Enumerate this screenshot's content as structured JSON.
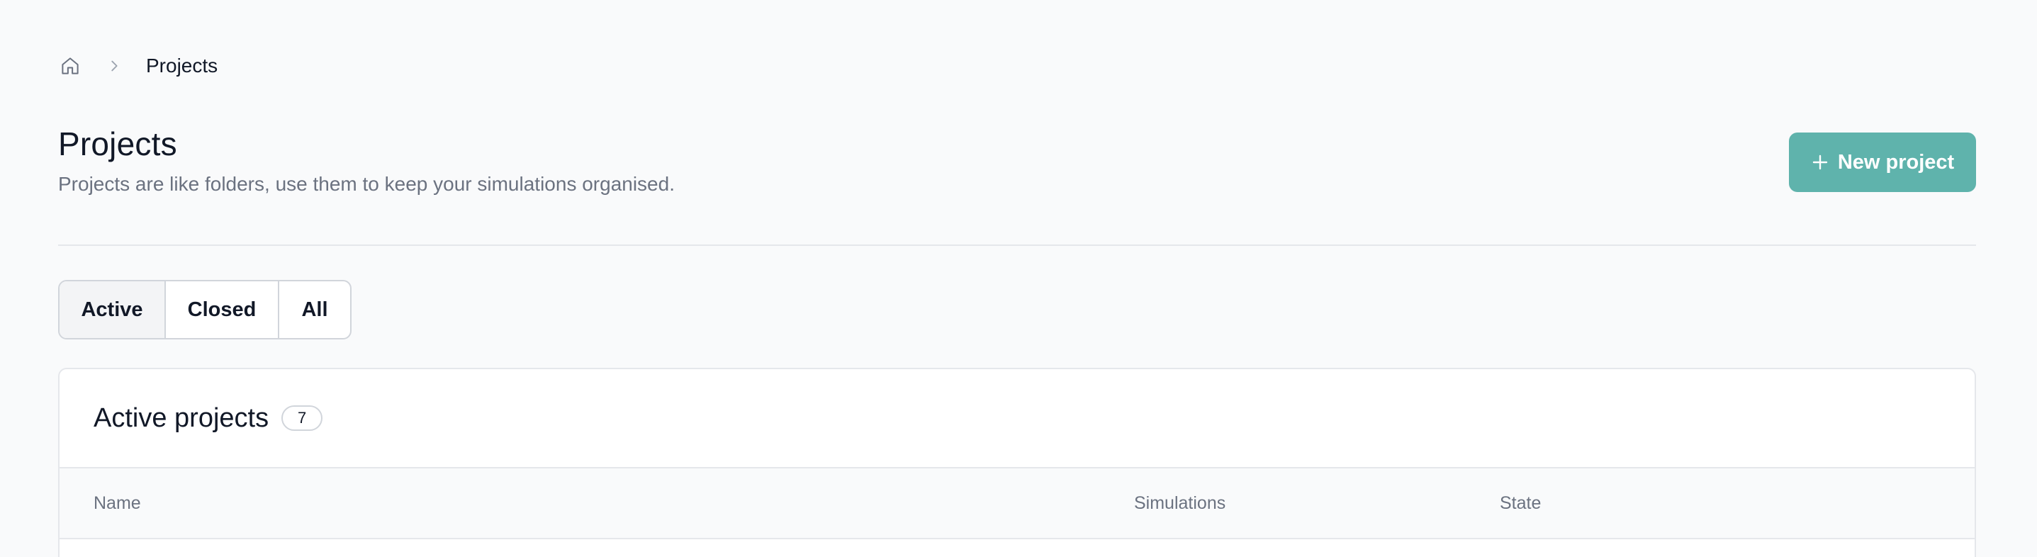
{
  "breadcrumb": {
    "home_icon": "home-icon",
    "separator_icon": "chevron-right-icon",
    "current": "Projects"
  },
  "header": {
    "title": "Projects",
    "subtitle": "Projects are like folders, use them to keep your simulations organised.",
    "new_project_label": "New project",
    "new_project_icon": "plus-icon"
  },
  "tabs": [
    {
      "label": "Active",
      "selected": true
    },
    {
      "label": "Closed",
      "selected": false
    },
    {
      "label": "All",
      "selected": false
    }
  ],
  "card": {
    "title": "Active projects",
    "count": "7"
  },
  "table": {
    "columns": [
      "Name",
      "Simulations",
      "State"
    ]
  },
  "colors": {
    "accent": "#5fb3ac",
    "background": "#f9fafb",
    "text": "#111827",
    "muted": "#6b7280",
    "border": "#e5e7eb"
  }
}
